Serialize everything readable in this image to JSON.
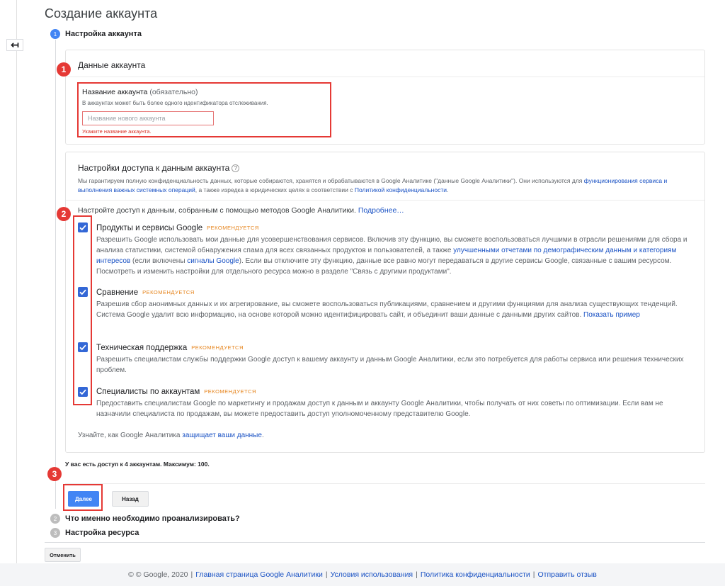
{
  "page": {
    "title": "Создание аккаунта",
    "back_glyph": "↤"
  },
  "steps": [
    {
      "num": "1",
      "label": "Настройка аккаунта",
      "color": "#4285f4"
    },
    {
      "num": "2",
      "label": "Что именно необходимо проанализировать?",
      "color": "#bdbdbd"
    },
    {
      "num": "3",
      "label": "Настройка ресурса",
      "color": "#bdbdbd"
    }
  ],
  "account_card": {
    "heading": "Данные аккаунта",
    "field_label": "Название аккаунта",
    "field_label_optional": "(обязательно)",
    "field_hint": "В аккаунтах может быть более одного идентификатора отслеживания.",
    "input_placeholder": "Название нового аккаунта",
    "input_value": "",
    "error": "Укажите название аккаунта."
  },
  "sharing_card": {
    "heading": "Настройки доступа к данным аккаунта",
    "help_glyph": "?",
    "desc_1": "Мы гарантируем полную конфиденциальность данных, которые собираются, хранятся и обрабатываются в Google Аналитике (\"данные Google Аналитики\"). Они используются для ",
    "desc_link_1": "функционирования сервиса и выполнения важных системных операций",
    "desc_2": ", а также изредка в юридических целях в соответствии с ",
    "desc_link_2": "Политикой конфиденциальности",
    "desc_3": ".",
    "intro": "Настройте доступ к данным, собранным с помощью методов Google Аналитики.",
    "intro_link": "Подробнее…",
    "recommended": "РЕКОМЕНДУЕТСЯ",
    "options": [
      {
        "title": "Продукты и сервисы Google",
        "checked": true,
        "desc_a": "Разрешить Google использовать мои данные для усовершенствования сервисов. Включив эту функцию, вы сможете воспользоваться лучшими в отрасли решениями для сбора и анализа статистики, системой обнаружения спама для всех связанных продуктов и пользователей, а также ",
        "link_a": "улучшенными отчетами по демографическим данным и категориям интересов",
        "desc_b": " (если включены ",
        "link_b": "сигналы Google",
        "desc_c": "). Если вы отключите эту функцию, данные все равно могут передаваться в другие сервисы Google, связанные с вашим ресурсом. Посмотреть и изменить настройки для отдельного ресурса можно в разделе \"Связь с другими продуктами\"."
      },
      {
        "title": "Сравнение",
        "checked": true,
        "desc_a": "Разрешив сбор анонимных данных и их агрегирование, вы сможете воспользоваться публикациями, сравнением и другими функциями для анализа существующих тенденций. Система Google удалит всю информацию, на основе которой можно идентифицировать сайт, и объединит ваши данные с данными других сайтов. ",
        "link_a": "Показать пример"
      },
      {
        "title": "Техническая поддержка",
        "checked": true,
        "desc_a": "Разрешить специалистам службы поддержки Google доступ к вашему аккаунту и данным Google Аналитики, если это потребуется для работы сервиса или решения технических проблем."
      },
      {
        "title": "Специалисты по аккаунтам",
        "checked": true,
        "desc_a": "Предоставить специалистам Google по маркетингу и продажам доступ к данным и аккаунту Google Аналитики, чтобы получать от них советы по оптимизации. Если вам не назначили специалиста по продажам, вы можете предоставить доступ уполномоченному представителю Google."
      }
    ],
    "protect_text": "Узнайте, как Google Аналитика ",
    "protect_link": "защищает ваши данные",
    "protect_end": "."
  },
  "access_info": "У вас есть доступ к 4 аккаунтам. Максимум: 100.",
  "buttons": {
    "next": "Далее",
    "back": "Назад",
    "cancel": "Отменить"
  },
  "annotations": [
    "1",
    "2",
    "3"
  ],
  "footer": {
    "copyright": "© © Google, 2020",
    "links": [
      "Главная страница Google Аналитики",
      "Условия использования",
      "Политика конфиденциальности",
      "Отправить отзыв"
    ]
  },
  "colors": {
    "accent": "#4285f4",
    "link": "#1a52c4",
    "recommended": "#e6841c",
    "annotation_red": "#e53935",
    "error": "#d93025"
  }
}
